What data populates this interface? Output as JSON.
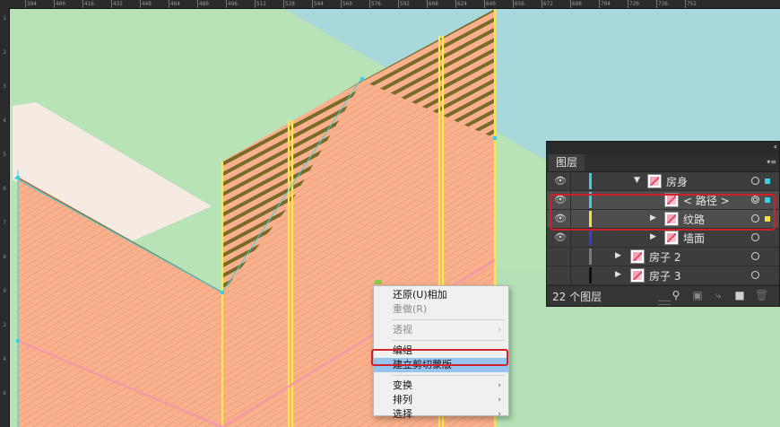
{
  "colors": {
    "sky": "#a8d8dc",
    "ground": "#b7e3b6",
    "wall": "#f9b08c",
    "stripe": "#e88f5e",
    "guide": "#ffe94a",
    "cream": "#f6ebe2",
    "pink_edge": "#f39aa6",
    "highlight": "#d0202a",
    "menu_hover": "#96c4ee"
  },
  "ruler": {
    "top_ticks": [
      "384",
      "400",
      "416",
      "432",
      "448",
      "464",
      "480",
      "496",
      "512",
      "528",
      "544",
      "560",
      "576",
      "592",
      "608",
      "624",
      "640",
      "656",
      "672",
      "688",
      "704",
      "720",
      "736",
      "752"
    ],
    "left_digits": [
      "1",
      "2",
      "3",
      "4",
      "5",
      "6",
      "7",
      "8",
      "9",
      "2",
      "4",
      "6"
    ]
  },
  "layers_panel": {
    "tab": "图层",
    "collapse": "‹‹",
    "menu_icon": "menu-icon",
    "rows": [
      {
        "label": "房身",
        "expanded": true,
        "color": "#37d1e6",
        "visible": true,
        "selected": false,
        "target": "single",
        "swatch": "#37d1e6"
      },
      {
        "label": "< 路径 >",
        "expanded": false,
        "color": "#37d1e6",
        "visible": true,
        "selected": true,
        "target": "double",
        "swatch": "#37d1e6"
      },
      {
        "label": "纹路",
        "expanded": false,
        "color": "#f4e23a",
        "visible": true,
        "selected": true,
        "target": "single",
        "swatch": "#f4e23a"
      },
      {
        "label": "墙面",
        "expanded": false,
        "color": "#3b3be0",
        "visible": true,
        "selected": false,
        "target": "single",
        "swatch": ""
      },
      {
        "label": "房子 2",
        "expanded": false,
        "color": "#7a7a7a",
        "visible": false,
        "selected": false,
        "target": "single",
        "swatch": ""
      },
      {
        "label": "房子 3",
        "expanded": false,
        "color": "#111111",
        "visible": false,
        "selected": false,
        "target": "single",
        "swatch": ""
      }
    ],
    "footer": {
      "count": "22 个图层",
      "icons": [
        "search-icon",
        "make-clipping-mask-icon",
        "new-sublayer-icon",
        "new-layer-icon",
        "trash-icon"
      ]
    }
  },
  "context_menu": {
    "items": [
      {
        "label": "还原(U)相加",
        "disabled": false,
        "submenu": false
      },
      {
        "label": "重做(R)",
        "disabled": true,
        "submenu": false
      },
      {
        "separator": true
      },
      {
        "label": "透视",
        "disabled": true,
        "submenu": true
      },
      {
        "separator": true
      },
      {
        "label": "编组",
        "disabled": false,
        "submenu": false
      },
      {
        "label": "建立剪切蒙版",
        "disabled": false,
        "submenu": false,
        "highlighted": true
      },
      {
        "separator": true
      },
      {
        "label": "变换",
        "disabled": false,
        "submenu": true
      },
      {
        "label": "排列",
        "disabled": false,
        "submenu": true
      },
      {
        "label": "选择",
        "disabled": false,
        "submenu": true
      }
    ]
  }
}
